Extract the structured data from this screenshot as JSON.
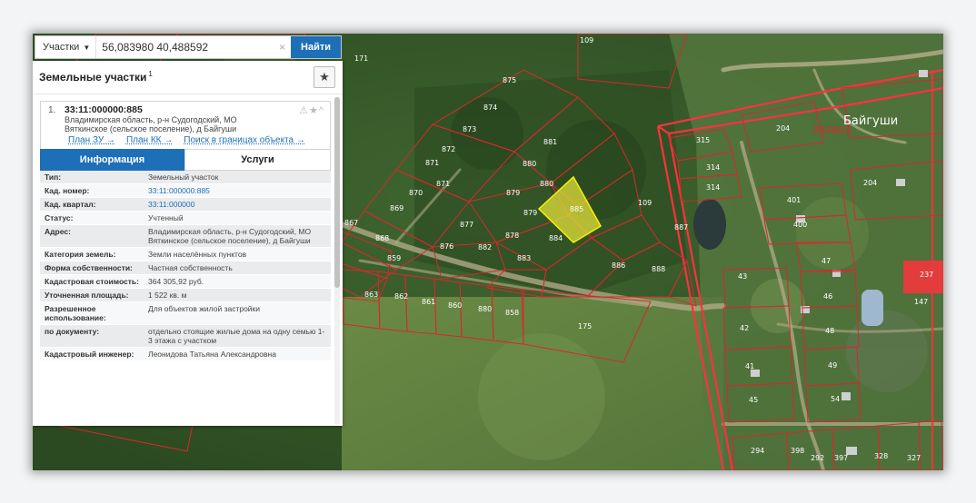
{
  "search": {
    "type_label": "Участки",
    "query": "56,083980 40,488592",
    "clear_label": "×",
    "find_label": "Найти"
  },
  "panel": {
    "title": "Земельные участки",
    "count": "1",
    "fav_icon": "★",
    "result": {
      "number": "1.",
      "code": "33:11:000000:885",
      "address": "Владимирская область, р-н Судогодский, МО Вяткинское (сельское поселение), д Байгуши",
      "status_icons": "⚠★^",
      "links": [
        "План ЗУ →",
        "План КК →",
        "Поиск в границах объекта →"
      ]
    },
    "tabs": {
      "info": "Информация",
      "services": "Услуги"
    },
    "rows": [
      {
        "k": "Тип:",
        "v": "Земельный участок"
      },
      {
        "k": "Кад. номер:",
        "v": "33:11:000000:885",
        "link": true
      },
      {
        "k": "Кад. квартал:",
        "v": "33:11:000000",
        "link": true
      },
      {
        "k": "Статус:",
        "v": "Учтенный"
      },
      {
        "k": "Адрес:",
        "v": "Владимирская область, р-н Судогодский, МО Вяткинское (сельское поселение), д Байгуши"
      },
      {
        "k": "Категория земель:",
        "v": "Земли населённых пунктов"
      },
      {
        "k": "Форма собственности:",
        "v": "Частная собственность"
      },
      {
        "k": "Кадастровая стоимость:",
        "v": "364 305,92 руб."
      },
      {
        "k": "Уточненная площадь:",
        "v": "1 522 кв. м"
      },
      {
        "k": "Разрешенное использование:",
        "v": "Для объектов жилой застройки"
      },
      {
        "k": "по документу:",
        "v": "отдельно стоящие жилые дома на одну семью 1-3 этажа с участком"
      },
      {
        "k": "Кадастровый инженер:",
        "v": "Леонидова Татьяна Александровна"
      }
    ]
  },
  "map": {
    "colors": {
      "parcel_border": "#d8282e",
      "selected_fill": "#e3e03a",
      "settlement_border": "#ff3040",
      "water": "#2b3a3a",
      "roof": "#e23c3c"
    },
    "place_name": "Байгуши",
    "place_code": "060801",
    "parcels": [
      {
        "label": "109"
      },
      {
        "label": "171"
      },
      {
        "label": "875"
      },
      {
        "label": "874"
      },
      {
        "label": "873"
      },
      {
        "label": "872"
      },
      {
        "label": "871"
      },
      {
        "label": "870"
      },
      {
        "label": "869"
      },
      {
        "label": "871"
      },
      {
        "label": "879"
      },
      {
        "label": "880"
      },
      {
        "label": "881"
      },
      {
        "label": "880"
      },
      {
        "label": "879"
      },
      {
        "label": "878"
      },
      {
        "label": "877"
      },
      {
        "label": "876"
      },
      {
        "label": "882"
      },
      {
        "label": "883"
      },
      {
        "label": "884"
      },
      {
        "label": "885"
      },
      {
        "label": "109"
      },
      {
        "label": "886"
      },
      {
        "label": "887"
      },
      {
        "label": "888"
      },
      {
        "label": "868"
      },
      {
        "label": "867"
      },
      {
        "label": "859"
      },
      {
        "label": "863"
      },
      {
        "label": "862"
      },
      {
        "label": "861"
      },
      {
        "label": "860"
      },
      {
        "label": "880"
      },
      {
        "label": "858"
      },
      {
        "label": "175"
      },
      {
        "label": "315"
      },
      {
        "label": "314"
      },
      {
        "label": "314"
      },
      {
        "label": "204"
      },
      {
        "label": "204"
      },
      {
        "label": "401"
      },
      {
        "label": "400"
      },
      {
        "label": "47"
      },
      {
        "label": "43"
      },
      {
        "label": "46"
      },
      {
        "label": "42"
      },
      {
        "label": "48"
      },
      {
        "label": "41"
      },
      {
        "label": "49"
      },
      {
        "label": "45"
      },
      {
        "label": "54"
      },
      {
        "label": "237"
      },
      {
        "label": "147"
      },
      {
        "label": "294"
      },
      {
        "label": "398"
      },
      {
        "label": "292"
      },
      {
        "label": "397"
      },
      {
        "label": "328"
      },
      {
        "label": "327"
      }
    ]
  }
}
